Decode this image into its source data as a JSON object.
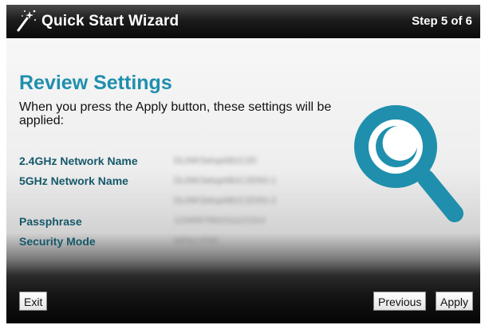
{
  "header": {
    "title": "Quick Start Wizard",
    "step": "Step 5 of 6",
    "icon": "magic-wand-icon"
  },
  "main": {
    "heading": "Review Settings",
    "intro": "When you press the Apply button, these settings will be applied:",
    "fields": [
      {
        "label": "2.4GHz Network Name",
        "value": "DLINKSetupAB1C2D"
      },
      {
        "label": "5GHz Network Name",
        "value": "DLINKSetupAB1C2D5G-1"
      },
      {
        "label": "",
        "value": "DLINKSetupAB1C2D5G-2"
      },
      {
        "label": "Passphrase",
        "value": "1234567891011121314"
      },
      {
        "label": "Security Mode",
        "value": "WPA2-PSK"
      }
    ],
    "illustration": "magnifying-glass-icon",
    "accent_color": "#1f8fad"
  },
  "footer": {
    "exit_label": "Exit",
    "previous_label": "Previous",
    "apply_label": "Apply"
  }
}
